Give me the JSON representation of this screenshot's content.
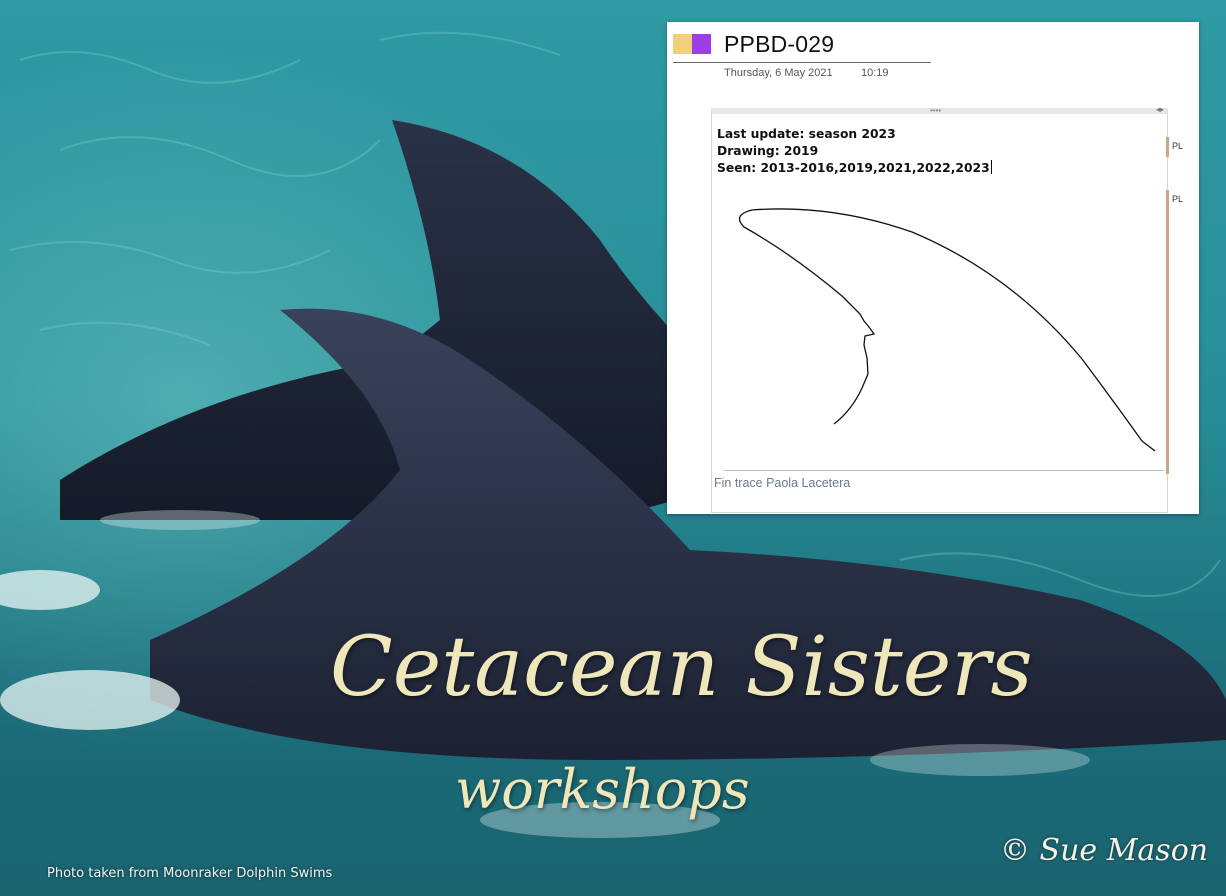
{
  "photo": {
    "credit": "Photo taken from Moonraker Dolphin Swims",
    "signature": "© Sue Mason"
  },
  "overlay": {
    "title": "Cetacean Sisters",
    "subtitle": "workshops"
  },
  "note_card": {
    "swatch_colors": [
      "#f2cf7b",
      "#9b3ee8"
    ],
    "title": "PPBD-029",
    "date": "Thursday, 6 May 2021",
    "time": "10:19",
    "lines": [
      "Last update: season 2023",
      "Drawing: 2019",
      "Seen: 2013-2016,2019,2021,2022,2023"
    ],
    "caption": "Fin trace Paola Lacetera",
    "author_tags": [
      "PL",
      "PL"
    ]
  }
}
